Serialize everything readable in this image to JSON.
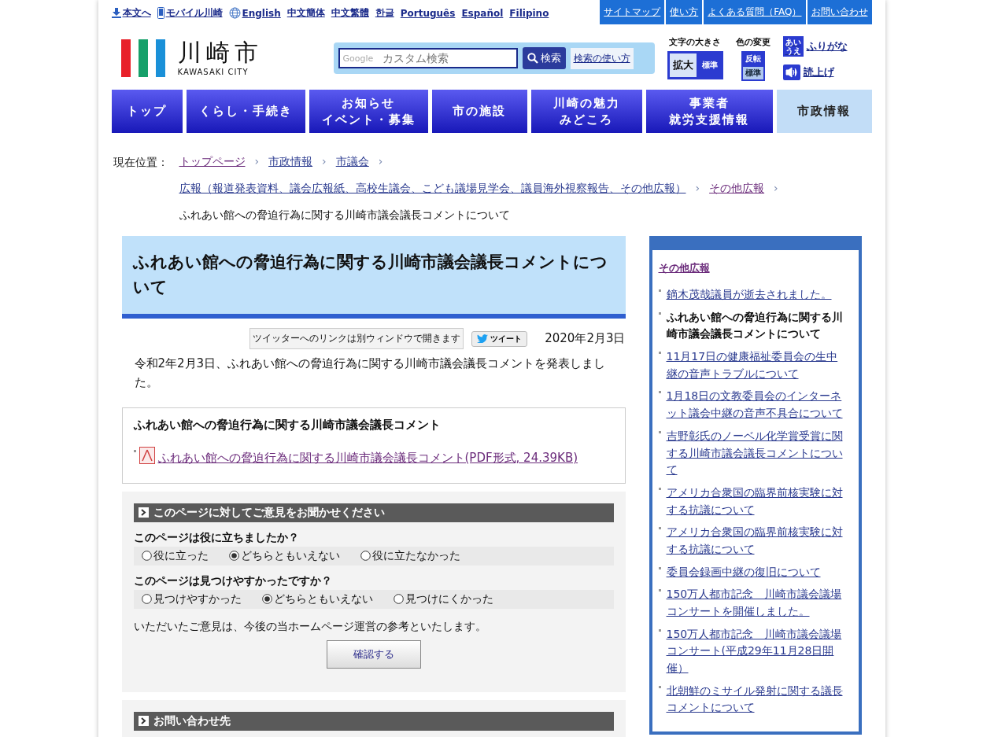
{
  "top_links": [
    {
      "label": "本文へ"
    },
    {
      "label": "モバイル川崎"
    },
    {
      "label": "English"
    },
    {
      "label": "中文簡体"
    },
    {
      "label": "中文繁體"
    },
    {
      "label": "한글"
    },
    {
      "label": "Português"
    },
    {
      "label": "Español"
    },
    {
      "label": "Filipino"
    }
  ],
  "utility_links": [
    "サイトマップ",
    "使い方",
    "よくある質問（FAQ）",
    "お問い合わせ"
  ],
  "logo": {
    "name": "川崎市",
    "sub": "KAWASAKI CITY"
  },
  "search": {
    "brand": "Google",
    "placeholder": "カスタム検索",
    "button": "検索",
    "help": "検索の使い方"
  },
  "text_size": {
    "label": "文字の大きさ",
    "buttons": [
      {
        "label": "拡大",
        "kind": "light"
      },
      {
        "label": "標準",
        "kind": "dark"
      }
    ]
  },
  "color_change": {
    "label": "色の変更",
    "buttons": [
      "反転",
      "標準"
    ]
  },
  "tools": [
    {
      "kind": "furigana",
      "icon_text": "あいうえ",
      "label": "ふりがな"
    },
    {
      "kind": "speech",
      "label": "読上げ"
    }
  ],
  "nav": [
    {
      "lines": [
        "トップ"
      ],
      "selected": false
    },
    {
      "lines": [
        "くらし・手続き"
      ],
      "selected": false
    },
    {
      "lines": [
        "お知らせ",
        "イベント・募集"
      ],
      "selected": false
    },
    {
      "lines": [
        "市の施設"
      ],
      "selected": false
    },
    {
      "lines": [
        "川崎の魅力",
        "みどころ"
      ],
      "selected": false
    },
    {
      "lines": [
        "事業者",
        "就労支援情報"
      ],
      "selected": false
    },
    {
      "lines": [
        "市政情報"
      ],
      "selected": true
    }
  ],
  "breadcrumb": {
    "label": "現在位置：",
    "items": [
      {
        "label": "トップページ",
        "visited": true
      },
      {
        "label": "市政情報",
        "visited": false
      },
      {
        "label": "市議会",
        "visited": false
      },
      {
        "label": "広報（報道発表資料、議会広報紙、高校生議会、こども議場見学会、議員海外視察報告、その他広報）",
        "visited": false
      },
      {
        "label": "その他広報",
        "visited": true
      }
    ],
    "separator": "›",
    "current": "ふれあい館への脅迫行為に関する川崎市議会議長コメントについて"
  },
  "article": {
    "title": "ふれあい館への脅迫行為に関する川崎市議会議長コメントについて",
    "share_note": "ツイッターへのリンクは別ウィンドウで開きます",
    "tweet": "ツイート",
    "date": "2020年2月3日",
    "body": "令和2年2月3日、ふれあい館への脅迫行為に関する川崎市議会議長コメントを発表しました。"
  },
  "attachment": {
    "heading": "ふれあい館への脅迫行為に関する川崎市議会議長コメント",
    "files": [
      {
        "label": "ふれあい館への脅迫行為に関する川崎市議会議長コメント(PDF形式, 24.39KB)"
      }
    ]
  },
  "feedback": {
    "heading": "このページに対してご意見をお聞かせください",
    "questions": [
      {
        "question": "このページは役に立ちましたか？",
        "options": [
          {
            "label": "役に立った",
            "selected": false
          },
          {
            "label": "どちらともいえない",
            "selected": true
          },
          {
            "label": "役に立たなかった",
            "selected": false
          }
        ]
      },
      {
        "question": "このページは見つけやすかったですか？",
        "options": [
          {
            "label": "見つけやすかった",
            "selected": false
          },
          {
            "label": "どちらともいえない",
            "selected": true
          },
          {
            "label": "見つけにくかった",
            "selected": false
          }
        ]
      }
    ],
    "note": "いただいたご意見は、今後の当ホームページ運営の参考といたします。",
    "button": "確認する"
  },
  "contact": {
    "heading": "お問い合わせ先"
  },
  "sidebar": {
    "heading": "その他広報",
    "items": [
      {
        "label": "鏑木茂哉議員が逝去されました。",
        "current": false
      },
      {
        "label": "ふれあい館への脅迫行為に関する川崎市議会議長コメントについて",
        "current": true
      },
      {
        "label": "11月17日の健康福祉委員会の生中継の音声トラブルについて",
        "current": false
      },
      {
        "label": "1月18日の文教委員会のインターネット議会中継の音声不具合について",
        "current": false
      },
      {
        "label": "吉野彰氏のノーベル化学賞受賞に関する川崎市議会議長コメントについて",
        "current": false
      },
      {
        "label": "アメリカ合衆国の臨界前核実験に対する抗議について",
        "current": false
      },
      {
        "label": "アメリカ合衆国の臨界前核実験に対する抗議について",
        "current": false
      },
      {
        "label": "委員会録画中継の復旧について",
        "current": false
      },
      {
        "label": "150万人都市記念　川崎市議会議場コンサートを開催しました。",
        "current": false
      },
      {
        "label": "150万人都市記念　川崎市議会議場コンサート(平成29年11月28日開催）",
        "current": false
      },
      {
        "label": "北朝鮮のミサイル発射に関する議長コメントについて",
        "current": false
      }
    ]
  }
}
